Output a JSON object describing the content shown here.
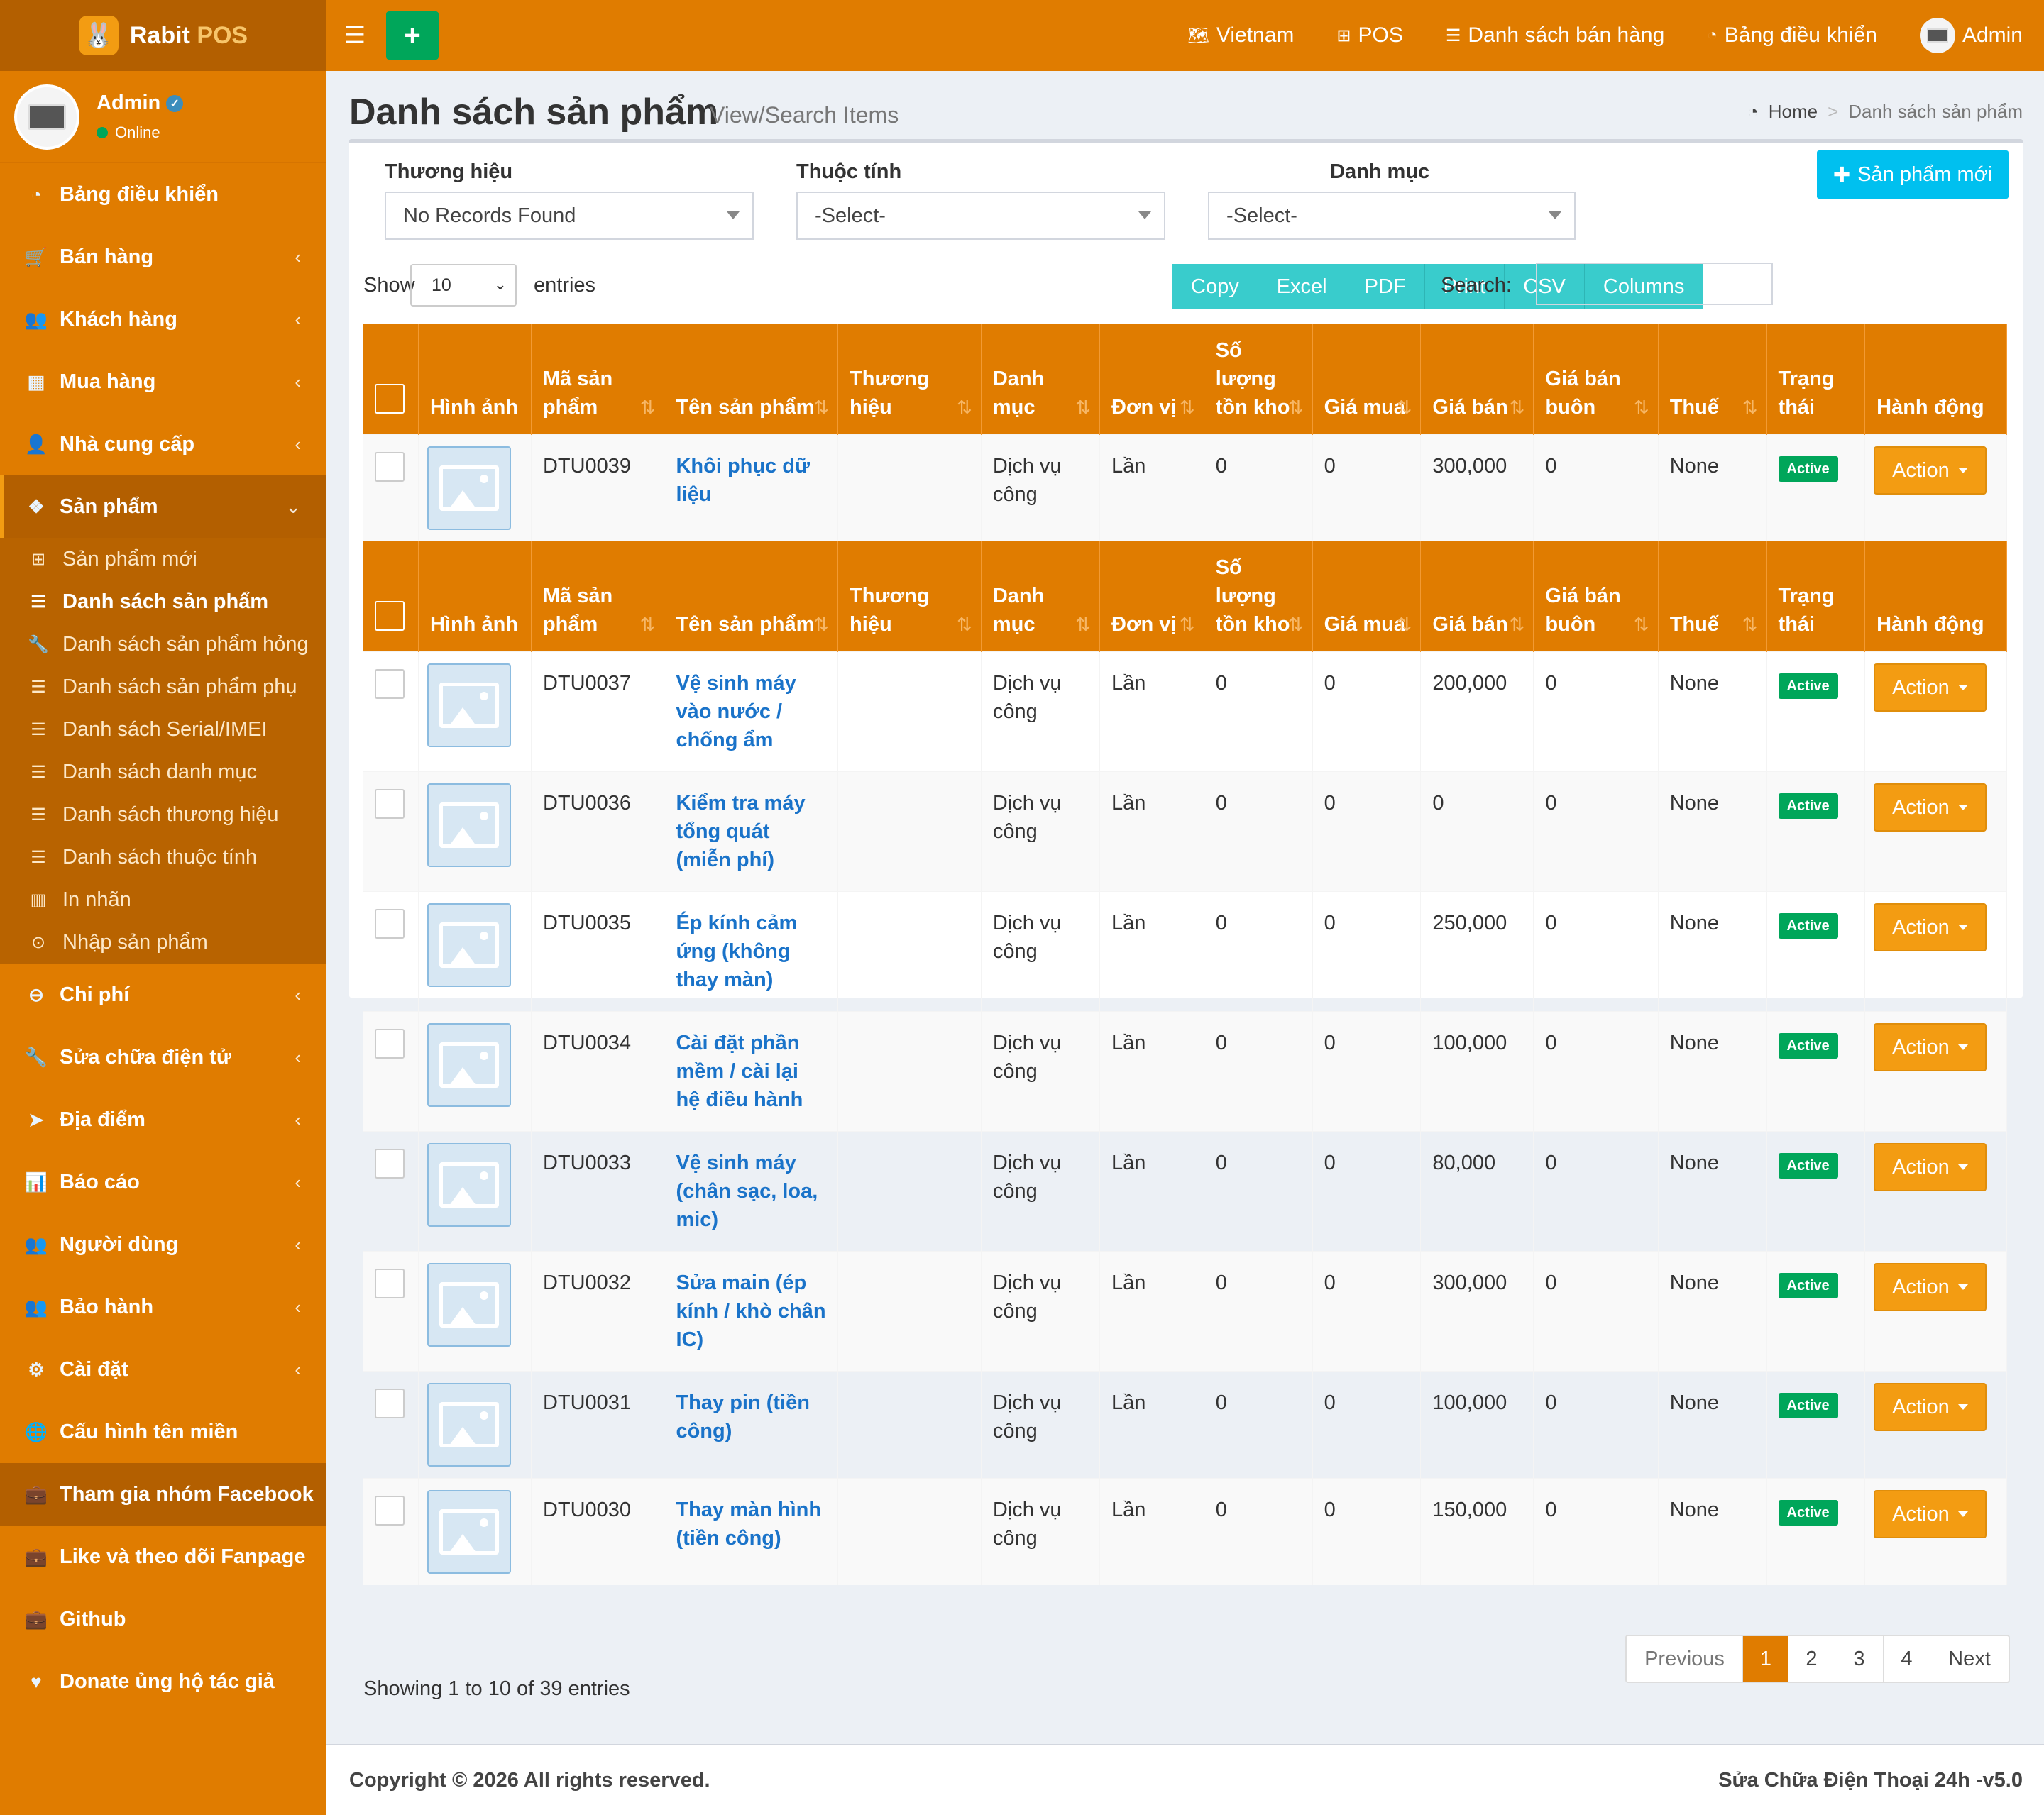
{
  "brand": {
    "name": "Rabit",
    "accent": "POS"
  },
  "user": {
    "name": "Admin",
    "status": "Online"
  },
  "sidebar": {
    "items": [
      {
        "label": "Bảng điều khiển"
      },
      {
        "label": "Bán hàng"
      },
      {
        "label": "Khách hàng"
      },
      {
        "label": "Mua hàng"
      },
      {
        "label": "Nhà cung cấp"
      },
      {
        "label": "Sản phẩm"
      },
      {
        "label": "Chi phí"
      },
      {
        "label": "Sửa chữa điện tử"
      },
      {
        "label": "Địa điểm"
      },
      {
        "label": "Báo cáo"
      },
      {
        "label": "Người dùng"
      },
      {
        "label": "Bảo hành"
      },
      {
        "label": "Cài đặt"
      },
      {
        "label": "Cấu hình tên miền"
      },
      {
        "label": "Tham gia nhóm Facebook"
      },
      {
        "label": "Like và theo dõi Fanpage"
      },
      {
        "label": "Github"
      },
      {
        "label": "Donate ủng hộ tác giả"
      }
    ],
    "submenu": [
      {
        "label": "Sản phẩm mới"
      },
      {
        "label": "Danh sách sản phẩm"
      },
      {
        "label": "Danh sách sản phẩm hỏng"
      },
      {
        "label": "Danh sách sản phẩm phụ"
      },
      {
        "label": "Danh sách Serial/IMEI"
      },
      {
        "label": "Danh sách danh mục"
      },
      {
        "label": "Danh sách thương hiệu"
      },
      {
        "label": "Danh sách thuộc tính"
      },
      {
        "label": "In nhãn"
      },
      {
        "label": "Nhập sản phẩm"
      }
    ]
  },
  "topnav": {
    "language": "Vietnam",
    "pos": "POS",
    "sales_list": "Danh sách bán hàng",
    "dashboard": "Bảng điều khiển",
    "admin": "Admin",
    "add_symbol": "+"
  },
  "page": {
    "title": "Danh sách sản phẩm",
    "subtitle": "View/Search Items"
  },
  "breadcrumb": {
    "home": "Home",
    "current": "Danh sách sản phẩm"
  },
  "filters": {
    "brand_label": "Thương hiệu",
    "brand_value": "No Records Found",
    "attribute_label": "Thuộc tính",
    "attribute_value": "-Select-",
    "category_label": "Danh mục",
    "category_value": "-Select-"
  },
  "new_product_label": "Sản phẩm mới",
  "table_controls": {
    "show": "Show",
    "entries_value": "10",
    "entries": "entries",
    "search_label": "Search:"
  },
  "export_buttons": [
    "Copy",
    "Excel",
    "PDF",
    "Print",
    "CSV",
    "Columns"
  ],
  "columns": [
    "Hình ảnh",
    "Mã sản phẩm",
    "Tên sản phẩm",
    "Thương hiệu",
    "Danh mục",
    "Đơn vị",
    "Số lượng tồn kho",
    "Giá mua",
    "Giá bán",
    "Giá bán buôn",
    "Thuế",
    "Trạng thái",
    "Hành động"
  ],
  "rows": [
    {
      "code": "DTU0039",
      "name": "Khôi phục dữ liệu",
      "brand": "",
      "category": "Dịch vụ công",
      "unit": "Lần",
      "stock": "0",
      "cost": "0",
      "price": "300,000",
      "wholesale": "0",
      "tax": "None",
      "status": "Active",
      "action": "Action"
    },
    {
      "code": "DTU0037",
      "name": "Vệ sinh máy vào nước / chống ẩm",
      "brand": "",
      "category": "Dịch vụ công",
      "unit": "Lần",
      "stock": "0",
      "cost": "0",
      "price": "200,000",
      "wholesale": "0",
      "tax": "None",
      "status": "Active",
      "action": "Action"
    },
    {
      "code": "DTU0036",
      "name": "Kiểm tra máy tổng quát (miễn phí)",
      "brand": "",
      "category": "Dịch vụ công",
      "unit": "Lần",
      "stock": "0",
      "cost": "0",
      "price": "0",
      "wholesale": "0",
      "tax": "None",
      "status": "Active",
      "action": "Action"
    },
    {
      "code": "DTU0035",
      "name": "Ép kính cảm ứng (không thay màn)",
      "brand": "",
      "category": "Dịch vụ công",
      "unit": "Lần",
      "stock": "0",
      "cost": "0",
      "price": "250,000",
      "wholesale": "0",
      "tax": "None",
      "status": "Active",
      "action": "Action"
    },
    {
      "code": "DTU0034",
      "name": "Cài đặt phần mềm / cài lại hệ điều hành",
      "brand": "",
      "category": "Dịch vụ công",
      "unit": "Lần",
      "stock": "0",
      "cost": "0",
      "price": "100,000",
      "wholesale": "0",
      "tax": "None",
      "status": "Active",
      "action": "Action"
    },
    {
      "code": "DTU0033",
      "name": "Vệ sinh máy (chân sạc, loa, mic)",
      "brand": "",
      "category": "Dịch vụ công",
      "unit": "Lần",
      "stock": "0",
      "cost": "0",
      "price": "80,000",
      "wholesale": "0",
      "tax": "None",
      "status": "Active",
      "action": "Action"
    },
    {
      "code": "DTU0032",
      "name": "Sửa main (ép kính / khò chân IC)",
      "brand": "",
      "category": "Dịch vụ công",
      "unit": "Lần",
      "stock": "0",
      "cost": "0",
      "price": "300,000",
      "wholesale": "0",
      "tax": "None",
      "status": "Active",
      "action": "Action"
    },
    {
      "code": "DTU0031",
      "name": "Thay pin (tiền công)",
      "brand": "",
      "category": "Dịch vụ công",
      "unit": "Lần",
      "stock": "0",
      "cost": "0",
      "price": "100,000",
      "wholesale": "0",
      "tax": "None",
      "status": "Active",
      "action": "Action"
    },
    {
      "code": "DTU0030",
      "name": "Thay màn hình (tiền công)",
      "brand": "",
      "category": "Dịch vụ công",
      "unit": "Lần",
      "stock": "0",
      "cost": "0",
      "price": "150,000",
      "wholesale": "0",
      "tax": "None",
      "status": "Active",
      "action": "Action"
    }
  ],
  "table_info": "Showing 1 to 10 of 39 entries",
  "pagination": {
    "previous": "Previous",
    "pages": [
      "1",
      "2",
      "3",
      "4"
    ],
    "next": "Next",
    "current": "1"
  },
  "footer": {
    "copyright": "Copyright © 2026 All rights reserved.",
    "version": "Sửa Chữa Điện Thoại 24h -v5.0"
  },
  "colors": {
    "primary": "#e07c00",
    "primary_dark": "#b35f00",
    "success": "#00a65a",
    "info": "#00c0ef",
    "teal": "#39cccc",
    "action": "#f39c12",
    "link": "#1a73c9"
  }
}
